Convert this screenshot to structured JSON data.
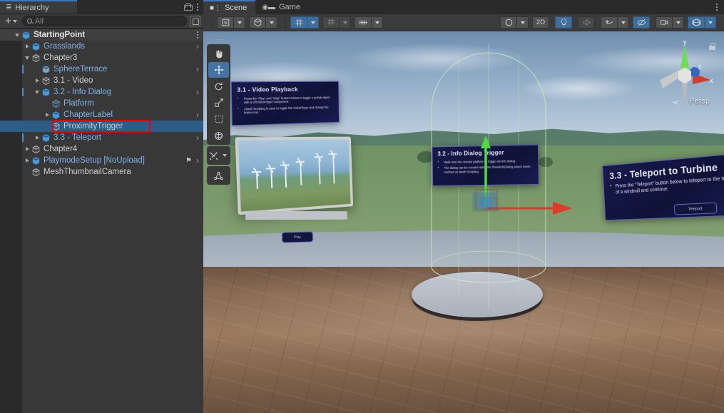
{
  "hierarchy": {
    "tab_label": "Hierarchy",
    "tab_icon": "hierarchy-icon",
    "lock_icon": "lock-icon",
    "menu_icon": "kebab-menu-icon",
    "create_label": "+",
    "search": {
      "placeholder": "All",
      "value": "",
      "icon": "search-icon"
    },
    "popout_icon": "popout-icon",
    "rows": [
      {
        "label": "StartingPoint",
        "indent": 0,
        "twisty": "down",
        "icon": "prefab-scene-icon",
        "kind": "root",
        "chevron": false,
        "prefab_bar": false,
        "tag": false
      },
      {
        "label": "Grasslands",
        "indent": 1,
        "twisty": "right",
        "icon": "prefab-icon",
        "kind": "prefab",
        "chevron": true,
        "prefab_bar": false,
        "tag": false
      },
      {
        "label": "Chapter3",
        "indent": 1,
        "twisty": "down",
        "icon": "gameobject-icon",
        "kind": "plain",
        "chevron": false,
        "prefab_bar": false,
        "tag": false
      },
      {
        "label": "SphereTerrace",
        "indent": 2,
        "twisty": "none",
        "icon": "model-icon",
        "kind": "prefab",
        "chevron": true,
        "prefab_bar": true,
        "tag": false
      },
      {
        "label": "3.1 - Video",
        "indent": 2,
        "twisty": "right",
        "icon": "gameobject-icon",
        "kind": "plain",
        "chevron": false,
        "prefab_bar": false,
        "tag": false
      },
      {
        "label": "3.2 - Info Dialog",
        "indent": 2,
        "twisty": "down",
        "icon": "prefab-icon",
        "kind": "prefab",
        "chevron": true,
        "prefab_bar": true,
        "tag": false
      },
      {
        "label": "Platform",
        "indent": 3,
        "twisty": "none",
        "icon": "gameobject-icon",
        "kind": "prefab",
        "chevron": false,
        "prefab_bar": false,
        "tag": false
      },
      {
        "label": "ChapterLabel",
        "indent": 3,
        "twisty": "right",
        "icon": "prefab-icon",
        "kind": "prefab",
        "chevron": true,
        "prefab_bar": false,
        "tag": false
      },
      {
        "label": "ProximityTrigger",
        "indent": 3,
        "twisty": "none",
        "icon": "gameobject-icon",
        "kind": "plain",
        "chevron": false,
        "prefab_bar": false,
        "tag": false
      },
      {
        "label": "3.3 - Teleport",
        "indent": 2,
        "twisty": "right",
        "icon": "prefab-icon",
        "kind": "prefab",
        "chevron": true,
        "prefab_bar": true,
        "tag": false
      },
      {
        "label": "Chapter4",
        "indent": 1,
        "twisty": "right",
        "icon": "gameobject-icon",
        "kind": "plain",
        "chevron": false,
        "prefab_bar": false,
        "tag": false
      },
      {
        "label": "PlaymodeSetup [NoUpload]",
        "indent": 1,
        "twisty": "right",
        "icon": "prefab-icon",
        "kind": "prefab",
        "chevron": true,
        "prefab_bar": false,
        "tag": true
      },
      {
        "label": "MeshThumbnailCamera",
        "indent": 1,
        "twisty": "none",
        "icon": "gameobject-icon",
        "kind": "plain",
        "chevron": false,
        "prefab_bar": false,
        "tag": false
      }
    ],
    "selected_index": 8,
    "highlight_index": 8,
    "highlight_color": "#ee0000"
  },
  "scene": {
    "tabs": [
      {
        "label": "Scene",
        "icon": "grid-icon",
        "active": true
      },
      {
        "label": "Game",
        "icon": "gamepad-icon",
        "active": false
      }
    ],
    "menu_icon": "kebab-menu-icon",
    "toolbar_left": [
      {
        "name": "pivot-mode-button",
        "icon": "pivot-icon",
        "label": "",
        "active": false,
        "dropdown": true,
        "dim": false
      },
      {
        "name": "handle-space-button",
        "icon": "global-cube-icon",
        "label": "",
        "active": false,
        "dropdown": true,
        "dim": false
      },
      {
        "name": "grid-snapping-button",
        "icon": "grid-snap-icon",
        "label": "",
        "active": true,
        "dropdown": true,
        "dim": false
      },
      {
        "name": "grid-visibility-button",
        "icon": "grid-plane-icon",
        "label": "",
        "active": false,
        "dropdown": true,
        "dim": true
      },
      {
        "name": "snap-increment-button",
        "icon": "ruler-icon",
        "label": "",
        "active": false,
        "dropdown": true,
        "dim": false
      }
    ],
    "toolbar_right": [
      {
        "name": "shading-mode-button",
        "icon": "shaded-sphere-icon",
        "label": "",
        "active": false,
        "dropdown": true,
        "dim": false
      },
      {
        "name": "2d-toggle-button",
        "icon": "",
        "label": "2D",
        "active": false,
        "dropdown": false,
        "dim": false
      },
      {
        "name": "scene-lighting-button",
        "icon": "lightbulb-icon",
        "label": "",
        "active": true,
        "dropdown": false,
        "dim": false
      },
      {
        "name": "audio-mute-button",
        "icon": "speaker-mute-icon",
        "label": "",
        "active": false,
        "dropdown": false,
        "dim": true
      },
      {
        "name": "effects-button",
        "icon": "fx-icon",
        "label": "",
        "active": false,
        "dropdown": true,
        "dim": false
      },
      {
        "name": "scene-visibility-button",
        "icon": "eye-off-icon",
        "label": "",
        "active": true,
        "dropdown": false,
        "dim": false
      },
      {
        "name": "camera-settings-button",
        "icon": "camera-icon",
        "label": "",
        "active": false,
        "dropdown": true,
        "dim": false
      },
      {
        "name": "gizmos-button",
        "icon": "gizmo-globe-icon",
        "label": "",
        "active": true,
        "dropdown": true,
        "dim": false
      }
    ],
    "tools": [
      {
        "name": "hand-tool",
        "icon": "hand-icon",
        "active": false
      },
      {
        "name": "move-tool",
        "icon": "move-icon",
        "active": true
      },
      {
        "name": "rotate-tool",
        "icon": "rotate-icon",
        "active": false
      },
      {
        "name": "scale-tool",
        "icon": "scale-icon",
        "active": false
      },
      {
        "name": "rect-tool",
        "icon": "rect-icon",
        "active": false
      },
      {
        "name": "transform-tool",
        "icon": "transform-icon",
        "active": false
      }
    ],
    "custom_tool": {
      "name": "custom-editor-tool",
      "icon": "wrench-screwdriver-icon",
      "active": false
    },
    "component_tool": {
      "name": "component-tool",
      "icon": "joint-node-icon",
      "active": false
    },
    "gizmo": {
      "axis_x_label": "x",
      "axis_y_label": "y",
      "axis_z_label": "z",
      "projection_label": "Persp",
      "back_arrow": "≺",
      "lock_icon": "lock-icon"
    },
    "panels": [
      {
        "name": "video-playback-panel",
        "title": "3.1 - Video Playback",
        "bullets": [
          "Press the \"Play\" and \"Stop\" buttons below to toggle a prefab object with a VRVideoPlayer component.",
          "Attach Scripting is used to toggle the VideoPlayer and change the button text."
        ]
      },
      {
        "name": "info-dialog-trigger-panel",
        "title": "3.2 - Info Dialog Trigger",
        "bullets": [
          "Walk onto the circular platform to trigger an info dialog.",
          "The dialog can be created using the ShowInfoDialog attach event method on Mesh Scripting."
        ]
      },
      {
        "name": "teleport-panel",
        "title": "3.3 - Teleport to Turbine",
        "bullets": [
          "Press the \"Teleport\" button below to teleport to the top of a windmill and continue."
        ],
        "button_label": "Teleport"
      }
    ],
    "video_screen": {
      "name": "video-screen",
      "button_label": "Play"
    }
  }
}
